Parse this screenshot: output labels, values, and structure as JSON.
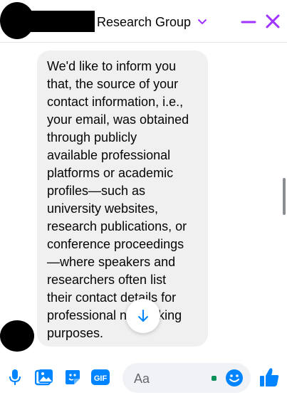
{
  "colors": {
    "accent": "#a033ff",
    "blue": "#0084ff",
    "bubble": "#f0f0f0"
  },
  "header": {
    "title": "Research Group",
    "icons": [
      "chevron-down-icon",
      "minimize-icon",
      "close-icon"
    ]
  },
  "message": {
    "text": "We'd like to inform you\nthat, the source of your\ncontact information, i.e.,\nyour email, was obtained\nthrough publicly\navailable professional\nplatforms or academic\nprofiles—such as\nuniversity websites,\nresearch publications, or\nconference proceedings\n—where speakers and\nresearchers often list\ntheir contact details for\nprofessional networking\npurposes."
  },
  "composer": {
    "placeholder": "Aa",
    "gif_label": "GIF",
    "icons": [
      "microphone-icon",
      "photo-icon",
      "sticker-icon",
      "gif-icon",
      "emoji-icon",
      "like-icon"
    ]
  }
}
